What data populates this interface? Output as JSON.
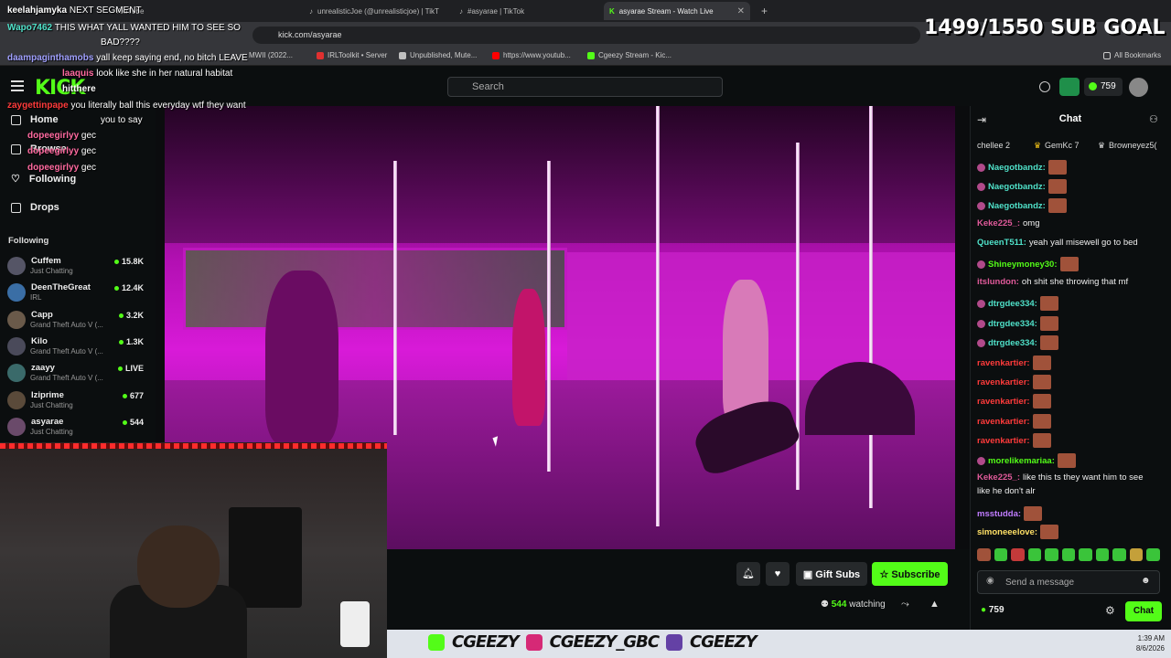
{
  "browser": {
    "tabs": [
      {
        "label": "YouTube",
        "active": false
      },
      {
        "label": "unrealisticJoe (@unrealisticjoe) | TikT",
        "active": false
      },
      {
        "label": "#asyarae | TikTok",
        "active": false
      },
      {
        "label": "asyarae Stream - Watch Live",
        "active": true
      }
    ],
    "url": "kick.com/asyarae",
    "bookmarks": [
      "IRLToolkit • Server",
      "Unpublished, Mute...",
      "https://www.youtub...",
      "Cgeezy Stream - Kic...",
      "All Bookmarks"
    ],
    "bookmark_partial": "MWII (2022..."
  },
  "header": {
    "logo": "KICK",
    "search_placeholder": "Search",
    "balance": "759"
  },
  "sidebar": {
    "nav": [
      {
        "label": "Home",
        "icon": "home-icon"
      },
      {
        "label": "Browse",
        "icon": "browse-icon"
      },
      {
        "label": "Following",
        "icon": "heart-icon"
      },
      {
        "label": "Drops",
        "icon": "drops-icon"
      }
    ],
    "following_header": "Following",
    "channels": [
      {
        "name": "Cuffem",
        "category": "Just Chatting",
        "viewers": "15.8K",
        "color": "#556"
      },
      {
        "name": "DeenTheGreat",
        "category": "IRL",
        "viewers": "12.4K",
        "color": "#3a6ea5"
      },
      {
        "name": "Capp",
        "category": "Grand Theft Auto V (...",
        "viewers": "3.2K",
        "color": "#6a5a4a"
      },
      {
        "name": "Kilo",
        "category": "Grand Theft Auto V (...",
        "viewers": "1.3K",
        "color": "#4a4a5a"
      },
      {
        "name": "zaayy",
        "category": "Grand Theft Auto V (...",
        "viewers": "LIVE",
        "color": "#3a6a6a"
      },
      {
        "name": "Iziprime",
        "category": "Just Chatting",
        "viewers": "677",
        "color": "#5a4a3a"
      },
      {
        "name": "asyarae",
        "category": "Just Chatting",
        "viewers": "544",
        "color": "#6a4a6a"
      }
    ]
  },
  "stream": {
    "gift_label": "Gift Subs",
    "subscribe_label": "Subscribe",
    "watching_count": "544",
    "watching_label": "watching"
  },
  "chat": {
    "title": "Chat",
    "top_gifters": [
      "chellee 2",
      "GemKc 7",
      "Browneyez5("
    ],
    "messages": [
      {
        "user": "Naegotbandz:",
        "text": "",
        "color": "#4fe0c8",
        "emote": true
      },
      {
        "user": "Naegotbandz:",
        "text": "",
        "color": "#4fe0c8",
        "emote": true
      },
      {
        "user": "Naegotbandz:",
        "text": "",
        "color": "#4fe0c8",
        "emote": true
      },
      {
        "user": "Keke225_:",
        "text": "omg",
        "color": "#e05a9a",
        "emote": false
      },
      {
        "user": "QueenT511:",
        "text": "yeah yall misewell go to bed",
        "color": "#4fe0c8",
        "emote": false
      },
      {
        "user": "Shineymoney30:",
        "text": "",
        "color": "#53fc18",
        "emote": true
      },
      {
        "user": "itslundon:",
        "text": "oh shit she throwing that mf",
        "color": "#e05a9a",
        "emote": false
      },
      {
        "user": "dtrgdee334:",
        "text": "",
        "color": "#4fe0c8",
        "emote": true
      },
      {
        "user": "dtrgdee334:",
        "text": "",
        "color": "#4fe0c8",
        "emote": true
      },
      {
        "user": "dtrgdee334:",
        "text": "",
        "color": "#4fe0c8",
        "emote": true
      },
      {
        "user": "ravenkartier:",
        "text": "",
        "color": "#ff3b3b",
        "emote": true
      },
      {
        "user": "ravenkartier:",
        "text": "",
        "color": "#ff3b3b",
        "emote": true
      },
      {
        "user": "ravenkartier:",
        "text": "",
        "color": "#ff3b3b",
        "emote": true
      },
      {
        "user": "ravenkartier:",
        "text": "",
        "color": "#ff3b3b",
        "emote": true
      },
      {
        "user": "ravenkartier:",
        "text": "",
        "color": "#ff3b3b",
        "emote": true
      },
      {
        "user": "morelikemariaa:",
        "text": "",
        "color": "#53fc18",
        "emote": true
      },
      {
        "user": "Keke225_:",
        "text": "like this ts they want him to see",
        "color": "#e05a9a",
        "emote": false
      },
      {
        "user": "",
        "text": "like he don't alr",
        "color": "#eee",
        "emote": false
      },
      {
        "user": "msstudda:",
        "text": "",
        "color": "#c07cff",
        "emote": true
      },
      {
        "user": "simoneeelove:",
        "text": "",
        "color": "#ffe066",
        "emote": true
      }
    ],
    "input_placeholder": "Send a message",
    "balance": "759",
    "send_label": "Chat"
  },
  "overlay": {
    "sub_goal": "1499/1550 SUB GOAL",
    "messages": [
      {
        "user": "keelahjamyka",
        "text": "NEXT SEGMENT",
        "color": "#fff"
      },
      {
        "user": "Wapo7462",
        "text": "THIS WHAT YALL WANTED HIM TO SEE SO",
        "color": "#4fe0c8"
      },
      {
        "user": "",
        "text": "BAD????",
        "color": "#fff"
      },
      {
        "user": "daampaginthamobs",
        "text": "yall keep saying end, no bitch LEAVE",
        "color": "#a0a0ff"
      },
      {
        "user": "laaquis",
        "text": "look like she in her natural habitat",
        "color": "#ff6aa0"
      },
      {
        "user": "hitthere",
        "text": "",
        "color": "#fff"
      },
      {
        "user": "zaygettinpape",
        "text": "you literally ball this everyday wtf they want",
        "color": "#ff3b3b"
      },
      {
        "user": "",
        "text": "you to say",
        "color": "#fff"
      },
      {
        "user": "dopeegirlyy",
        "text": "gec",
        "color": "#ff6aa0"
      },
      {
        "user": "dopeegirlyy",
        "text": "gec",
        "color": "#ff6aa0"
      },
      {
        "user": "dopeegirlyy",
        "text": "gec",
        "color": "#ff6aa0"
      }
    ],
    "banner": [
      "CGEEZY",
      "CGEEZY_GBC",
      "CGEEZY"
    ],
    "clock_time": "1:39 AM",
    "clock_date": "8/6/2026"
  },
  "colors": {
    "accent": "#53fc18",
    "bg": "#0b0e0f"
  }
}
